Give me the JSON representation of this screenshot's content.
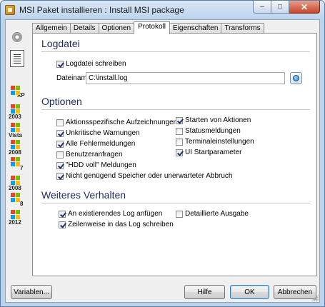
{
  "window": {
    "title": "MSI Paket installieren : Install MSI package",
    "minimize_glyph": "–",
    "maximize_glyph": "□",
    "close_glyph": "✕"
  },
  "tabs": [
    {
      "label": "Allgemein"
    },
    {
      "label": "Details"
    },
    {
      "label": "Optionen"
    },
    {
      "label": "Protokoll",
      "active": true
    },
    {
      "label": "Eigenschaften"
    },
    {
      "label": "Transforms"
    }
  ],
  "left_rail": {
    "items": [
      {
        "icon": "target-icon"
      },
      {
        "icon": "log-document-icon"
      },
      {
        "icon": "windows-logo-icon",
        "label": "XP"
      },
      {
        "icon": "windows-logo-icon",
        "label": "2003"
      },
      {
        "icon": "windows-logo-icon",
        "label": "Vista"
      },
      {
        "icon": "windows-logo-icon",
        "label": "2008"
      },
      {
        "icon": "windows-logo-icon",
        "label": "7"
      },
      {
        "icon": "windows-logo-icon",
        "label": "2008"
      },
      {
        "icon": "windows-logo-icon",
        "label": "8"
      },
      {
        "icon": "windows-logo-icon",
        "label": "2012"
      }
    ]
  },
  "logdatei": {
    "title": "Logdatei",
    "write_log_label": "Logdatei schreiben",
    "write_log_checked": true,
    "filename_label": "Dateiname",
    "filename_value": "C:\\install.log"
  },
  "optionen": {
    "title": "Optionen",
    "left": [
      {
        "label": "Aktionsspezifische Aufzeichnungen",
        "checked": false
      },
      {
        "label": "Unkritische Warnungen",
        "checked": true
      },
      {
        "label": "Alle Fehlermeldungen",
        "checked": true
      },
      {
        "label": "Benutzeranfragen",
        "checked": false
      },
      {
        "label": "\"HDD voll\" Meldungen",
        "checked": true
      },
      {
        "label": "Nicht genügend Speicher oder unerwarteter Abbruch",
        "checked": true
      }
    ],
    "right": [
      {
        "label": "Starten von Aktionen",
        "checked": true
      },
      {
        "label": "Statusmeldungen",
        "checked": false
      },
      {
        "label": "Terminaleinstellungen",
        "checked": false
      },
      {
        "label": "UI Startparameter",
        "checked": true
      }
    ]
  },
  "weiteres": {
    "title": "Weiteres Verhalten",
    "append_label": "An existierendes Log anfügen",
    "append_checked": true,
    "line_label": "Zeilenweise in das Log schreiben",
    "line_checked": true,
    "detailed_label": "Detaillierte Ausgabe",
    "detailed_checked": false
  },
  "buttons": {
    "variables": "Variablen...",
    "help": "Hilfe",
    "ok": "OK",
    "cancel": "Abbrechen"
  }
}
